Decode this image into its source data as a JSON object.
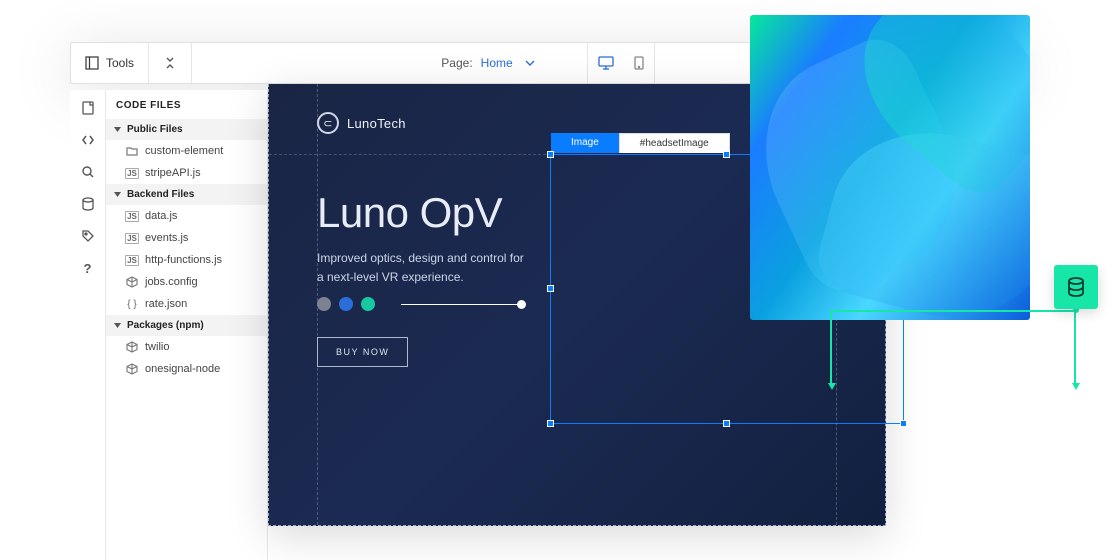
{
  "toolbar": {
    "tools_label": "Tools",
    "page_label": "Page:",
    "page_name": "Home",
    "search_label": "Search"
  },
  "files_panel": {
    "title": "CODE FILES",
    "groups": [
      {
        "label": "Public Files",
        "items": [
          {
            "icon": "folder",
            "name": "custom-element"
          },
          {
            "icon": "js",
            "name": "stripeAPI.js"
          }
        ]
      },
      {
        "label": "Backend Files",
        "items": [
          {
            "icon": "js",
            "name": "data.js"
          },
          {
            "icon": "js",
            "name": "events.js"
          },
          {
            "icon": "js",
            "name": "http-functions.js"
          },
          {
            "icon": "config",
            "name": "jobs.config"
          },
          {
            "icon": "json",
            "name": "rate.json"
          }
        ]
      },
      {
        "label": "Packages (npm)",
        "items": [
          {
            "icon": "pkg",
            "name": "twilio"
          },
          {
            "icon": "pkg",
            "name": "onesignal-node"
          }
        ]
      }
    ]
  },
  "canvas": {
    "brand_name": "LunoTech",
    "hero_title": "Luno OpV",
    "hero_subtitle": "Improved optics, design and control for a next-level VR experience.",
    "cta_label": "BUY NOW",
    "swatch_colors": [
      "#7d8293",
      "#2b6edb",
      "#17c9a0"
    ]
  },
  "selection": {
    "tab_active": "Image",
    "tab_id": "#headsetImage"
  },
  "colors": {
    "accent_blue": "#0a7cff",
    "accent_green": "#17e6a8",
    "canvas_bg_from": "#1a2544",
    "canvas_bg_to": "#12203f"
  }
}
